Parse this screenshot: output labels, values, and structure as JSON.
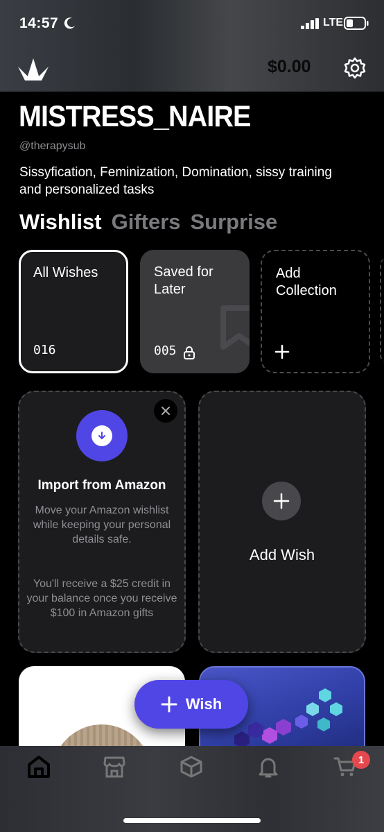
{
  "status_bar": {
    "time": "14:57",
    "network": "LTE"
  },
  "header": {
    "balance": "$0.00"
  },
  "profile": {
    "username": "MISTRESS_NAIRE",
    "handle": "@therapysub",
    "bio": "Sissyfication, Feminization, Domination, sissy training and personalized tasks"
  },
  "tabs": [
    {
      "label": "Wishlist",
      "active": true
    },
    {
      "label": "Gifters",
      "active": false
    },
    {
      "label": "Surprise",
      "active": false
    }
  ],
  "collections": [
    {
      "label": "All Wishes",
      "count": "016"
    },
    {
      "label": "Saved for Later",
      "count": "005"
    },
    {
      "label": "Add Collection"
    }
  ],
  "import_card": {
    "title": "Import from Amazon",
    "description": "Move your Amazon wishlist while keeping your personal details safe.",
    "credit_note": "You'll receive a $25 credit in your balance once you receive $100 in Amazon gifts"
  },
  "add_card": {
    "label": "Add Wish"
  },
  "fab": {
    "label": "Wish"
  },
  "nav": {
    "cart_badge": "1"
  },
  "colors": {
    "accent": "#5046e5",
    "badge": "#e5484d"
  },
  "icons": [
    "moon-icon",
    "signal-icon",
    "battery-icon",
    "logo-icon",
    "gear-icon",
    "lock-icon",
    "bookmark-icon",
    "plus-icon",
    "close-icon",
    "download-icon",
    "home-icon",
    "store-icon",
    "box-icon",
    "bell-icon",
    "cart-icon"
  ]
}
